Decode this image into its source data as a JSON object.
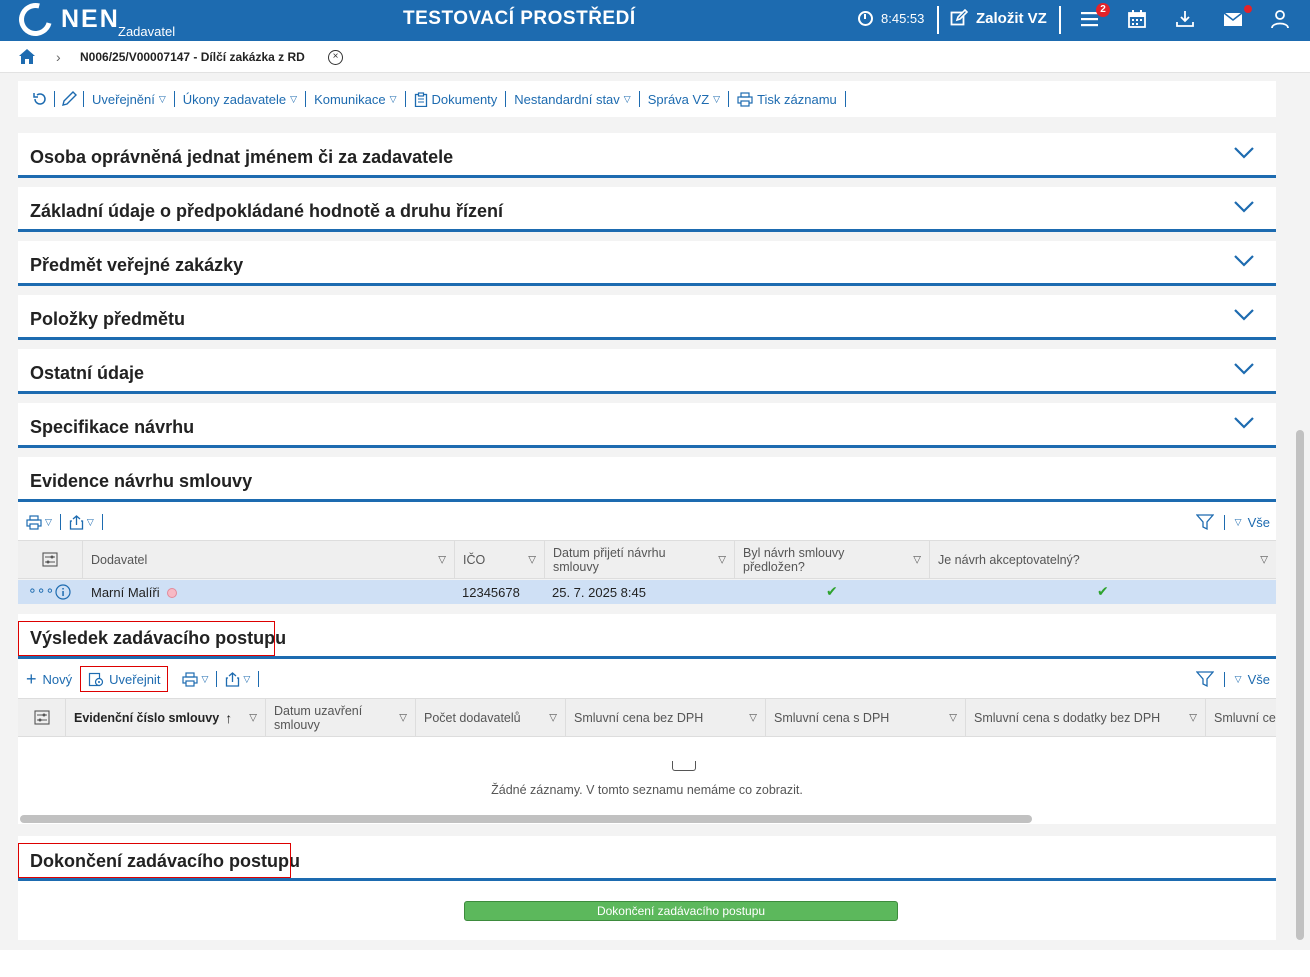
{
  "header": {
    "logo": "NEN",
    "logo_sub": "Zadavatel",
    "env_title": "TESTOVACÍ PROSTŘEDÍ",
    "time": "8:45:53",
    "new_vz": "Založit VZ",
    "menu_badge": "2",
    "colors": {
      "primary": "#1d6bb0",
      "badge": "#e3232a"
    }
  },
  "breadcrumb": {
    "text": "N006/25/V00007147 - Dílčí zakázka z RD",
    "close": "×"
  },
  "toolbar": {
    "items": [
      "Uveřejnění",
      "Úkony zadavatele",
      "Komunikace",
      "Dokumenty",
      "Nestandardní stav",
      "Správa VZ",
      "Tisk záznamu"
    ]
  },
  "sections": [
    "Osoba oprávněná jednat jménem či za zadavatele",
    "Základní údaje o předpokládané hodnotě a druhu řízení",
    "Předmět veřejné zakázky",
    "Položky předmětu",
    "Ostatní údaje",
    "Specifikace návrhu"
  ],
  "evidence": {
    "title": "Evidence návrhu smlouvy",
    "filter_all": "Vše",
    "columns": [
      "Dodavatel",
      "IČO",
      "Datum přijetí návrhu smlouvy",
      "Byl návrh smlouvy předložen?",
      "Je návrh akceptovatelný?"
    ],
    "row": {
      "dodavatel": "Marní Malíři",
      "ico": "12345678",
      "datum": "25. 7. 2025 8:45",
      "predlozen": "✔",
      "akceptovatelny": "✔"
    }
  },
  "vysledek": {
    "title": "Výsledek zadávacího postupu",
    "new_label": "Nový",
    "publish_label": "Uveřejnit",
    "filter_all": "Vše",
    "columns": [
      "Evidenční číslo smlouvy",
      "Datum uzavření smlouvy",
      "Počet dodavatelů",
      "Smluvní cena bez DPH",
      "Smluvní cena s DPH",
      "Smluvní cena s dodatky bez DPH",
      "Smluvní ce"
    ],
    "empty_text": "Žádné záznamy. V tomto seznamu nemáme co zobrazit."
  },
  "dokonceni": {
    "title": "Dokončení zadávacího postupu",
    "button": "Dokončení zadávacího postupu"
  }
}
